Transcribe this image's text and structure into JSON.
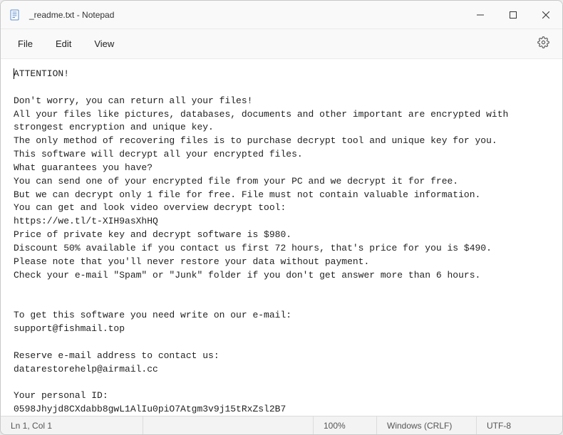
{
  "titlebar": {
    "title": "_readme.txt - Notepad"
  },
  "menu": {
    "file": "File",
    "edit": "Edit",
    "view": "View"
  },
  "content": {
    "text": "ATTENTION!\n\nDon't worry, you can return all your files!\nAll your files like pictures, databases, documents and other important are encrypted with strongest encryption and unique key.\nThe only method of recovering files is to purchase decrypt tool and unique key for you.\nThis software will decrypt all your encrypted files.\nWhat guarantees you have?\nYou can send one of your encrypted file from your PC and we decrypt it for free.\nBut we can decrypt only 1 file for free. File must not contain valuable information.\nYou can get and look video overview decrypt tool:\nhttps://we.tl/t-XIH9asXhHQ\nPrice of private key and decrypt software is $980.\nDiscount 50% available if you contact us first 72 hours, that's price for you is $490.\nPlease note that you'll never restore your data without payment.\nCheck your e-mail \"Spam\" or \"Junk\" folder if you don't get answer more than 6 hours.\n\n\nTo get this software you need write on our e-mail:\nsupport@fishmail.top\n\nReserve e-mail address to contact us:\ndatarestorehelp@airmail.cc\n\nYour personal ID:\n0598Jhyjd8CXdabb8gwL1AlIu0piO7Atgm3v9j15tRxZsl2B7"
  },
  "status": {
    "position": "Ln 1, Col 1",
    "zoom": "100%",
    "line_ending": "Windows (CRLF)",
    "encoding": "UTF-8"
  }
}
